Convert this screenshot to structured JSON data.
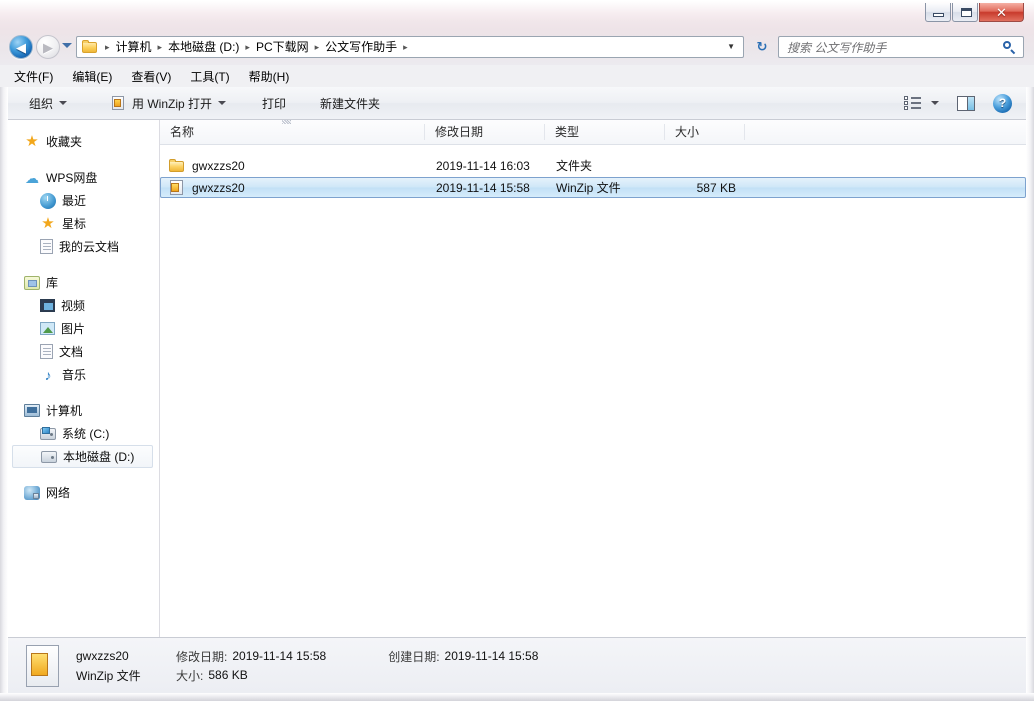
{
  "window": {
    "minimize_label": "–",
    "maximize_label": "□",
    "close_label": "✕"
  },
  "address": {
    "back_glyph": "◀",
    "forward_glyph": "▶",
    "crumbs": [
      "计算机",
      "本地磁盘 (D:)",
      "PC下载网",
      "公文写作助手"
    ],
    "separator": "▸",
    "dropdown_glyph": "▼",
    "refresh_glyph": "↻"
  },
  "search": {
    "placeholder": "搜索 公文写作助手"
  },
  "menubar": {
    "items": [
      {
        "label": "文件(F)"
      },
      {
        "label": "编辑(E)"
      },
      {
        "label": "查看(V)"
      },
      {
        "label": "工具(T)"
      },
      {
        "label": "帮助(H)"
      }
    ]
  },
  "toolbar": {
    "organize_label": "组织",
    "openwith_label": "用 WinZip 打开",
    "print_label": "打印",
    "newfolder_label": "新建文件夹",
    "help_label": "?"
  },
  "sidebar": {
    "items": [
      {
        "label": "收藏夹",
        "icon": "star-icon",
        "level": "root"
      },
      {
        "label": "WPS网盘",
        "icon": "cloud-icon",
        "level": "root"
      },
      {
        "label": "最近",
        "icon": "clock-icon",
        "level": "child"
      },
      {
        "label": "星标",
        "icon": "star-icon",
        "level": "child"
      },
      {
        "label": "我的云文档",
        "icon": "document-icon",
        "level": "child"
      },
      {
        "label": "库",
        "icon": "library-icon",
        "level": "root"
      },
      {
        "label": "视频",
        "icon": "video-icon",
        "level": "child"
      },
      {
        "label": "图片",
        "icon": "picture-icon",
        "level": "child"
      },
      {
        "label": "文档",
        "icon": "document-icon",
        "level": "child"
      },
      {
        "label": "音乐",
        "icon": "music-icon",
        "level": "child"
      },
      {
        "label": "计算机",
        "icon": "computer-icon",
        "level": "root"
      },
      {
        "label": "系统 (C:)",
        "icon": "harddisk-windows-icon",
        "level": "child"
      },
      {
        "label": "本地磁盘 (D:)",
        "icon": "harddisk-icon",
        "level": "child",
        "selected": true
      },
      {
        "label": "网络",
        "icon": "network-icon",
        "level": "root"
      }
    ]
  },
  "filelist": {
    "columns": [
      {
        "label": "名称"
      },
      {
        "label": "修改日期"
      },
      {
        "label": "类型"
      },
      {
        "label": "大小"
      }
    ],
    "rows": [
      {
        "name": "gwxzzs20",
        "modified": "2019-11-14 16:03",
        "type": "文件夹",
        "size": "",
        "icon": "folder-icon",
        "selected": false
      },
      {
        "name": "gwxzzs20",
        "modified": "2019-11-14 15:58",
        "type": "WinZip 文件",
        "size": "587 KB",
        "icon": "winzip-file-icon",
        "selected": true
      }
    ]
  },
  "details": {
    "name": "gwxzzs20",
    "type": "WinZip 文件",
    "modified_label": "修改日期:",
    "modified_value": "2019-11-14 15:58",
    "created_label": "创建日期:",
    "created_value": "2019-11-14 15:58",
    "size_label": "大小:",
    "size_value": "586 KB"
  },
  "colors": {
    "selection_border": "#7da2ce",
    "selection_fill": "#c2e0f6",
    "accent_blue": "#1667b4",
    "close_red": "#c83a2c",
    "folder_yellow": "#fcd264"
  }
}
